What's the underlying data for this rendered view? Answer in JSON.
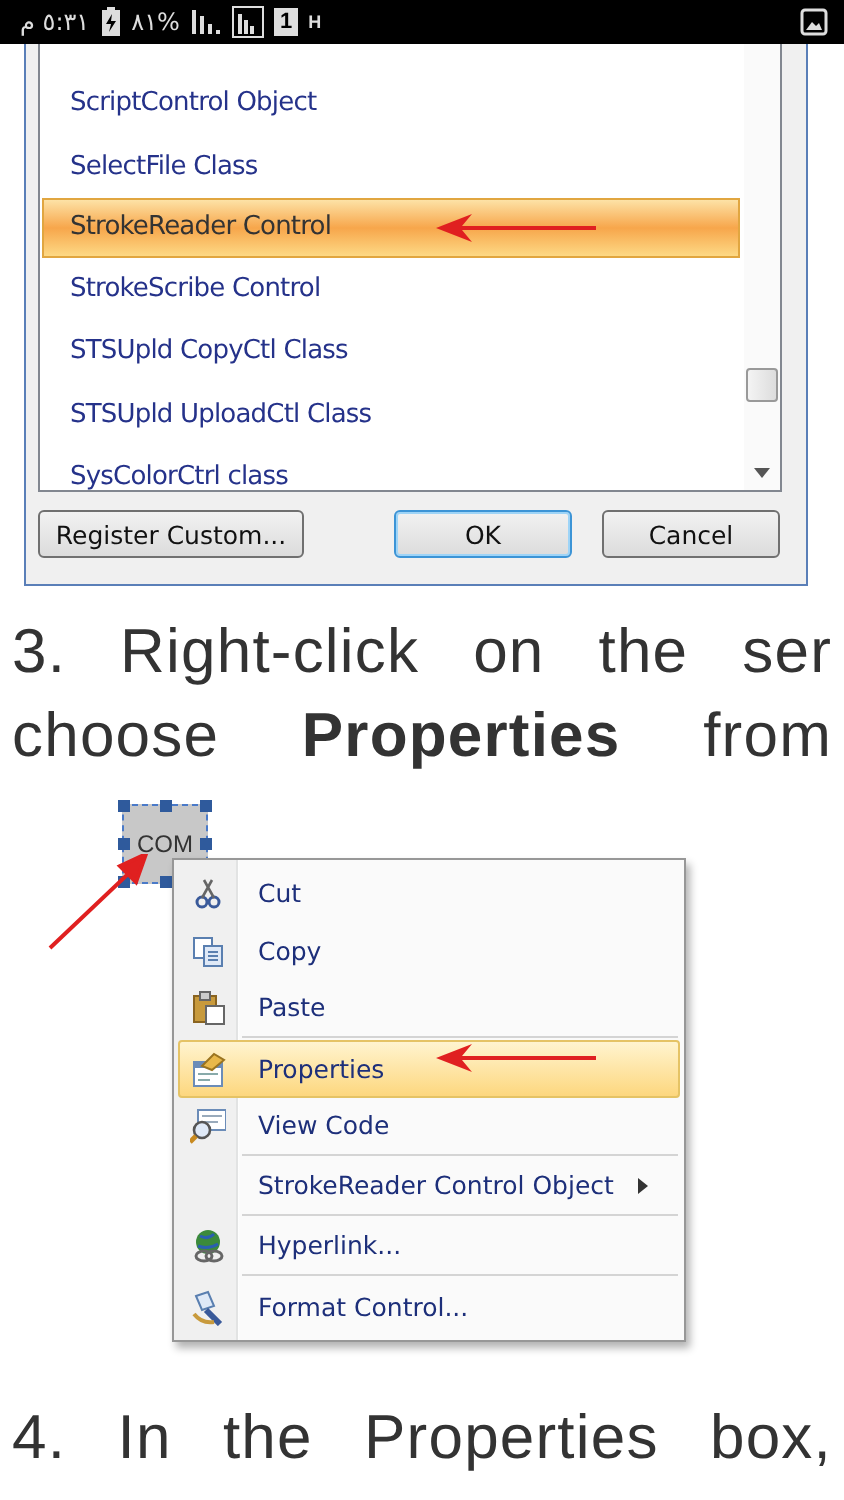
{
  "status_bar": {
    "time": "٥:٣١ م",
    "battery": "%٨١",
    "sim": "1",
    "network": "H"
  },
  "dialog": {
    "items": [
      {
        "label": "ScriptControl Object",
        "selected": false
      },
      {
        "label": "SelectFile Class",
        "selected": false
      },
      {
        "label": "StrokeReader Control",
        "selected": true
      },
      {
        "label": "StrokeScribe Control",
        "selected": false
      },
      {
        "label": "STSUpld CopyCtl Class",
        "selected": false
      },
      {
        "label": "STSUpld UploadCtl Class",
        "selected": false
      },
      {
        "label": "SysColorCtrl class",
        "selected": false
      }
    ],
    "buttons": [
      {
        "label": "Register Custom...",
        "default": false
      },
      {
        "label": "OK",
        "default": true
      },
      {
        "label": "Cancel",
        "default": false
      }
    ]
  },
  "step_3": {
    "lines": [
      "3. Right-click on the ser",
      "choose **Properties** from"
    ]
  },
  "control": {
    "label": "COM"
  },
  "context_menu": {
    "items": [
      {
        "label": "Cut",
        "selected": false,
        "submenu": false,
        "separator_after": false
      },
      {
        "label": "Copy",
        "selected": false,
        "submenu": false,
        "separator_after": false
      },
      {
        "label": "Paste",
        "selected": false,
        "submenu": false,
        "separator_after": true
      },
      {
        "label": "Properties",
        "selected": true,
        "submenu": false,
        "separator_after": false
      },
      {
        "label": "View Code",
        "selected": false,
        "submenu": false,
        "separator_after": true
      },
      {
        "label": "StrokeReader Control Object",
        "selected": false,
        "submenu": true,
        "separator_after": true
      },
      {
        "label": "Hyperlink...",
        "selected": false,
        "submenu": false,
        "separator_after": true
      },
      {
        "label": "Format Control...",
        "selected": false,
        "submenu": false,
        "separator_after": false
      }
    ]
  },
  "step_4": {
    "lines": [
      "4. In the Properties box,"
    ]
  }
}
